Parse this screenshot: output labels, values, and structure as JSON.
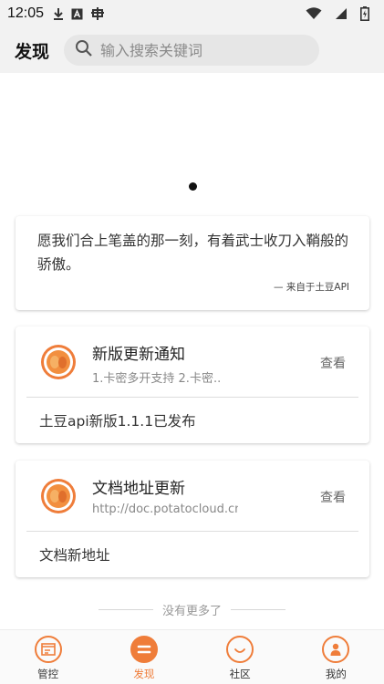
{
  "status_bar": {
    "time": "12:05",
    "icons": [
      "download-icon",
      "app-a-icon",
      "bug-icon",
      "wifi-icon",
      "signal-icon",
      "battery-icon"
    ]
  },
  "header": {
    "title": "发现",
    "search_placeholder": "输入搜索关键词"
  },
  "quote": {
    "text": "愿我们合上笔盖的那一刻，有着武士收刀入鞘般的骄傲。",
    "source": "— 来自于土豆API"
  },
  "notices": [
    {
      "title": "新版更新通知",
      "subtitle": "1.卡密多开支持 2.卡密..",
      "view_label": "查看",
      "body": "土豆api新版1.1.1已发布"
    },
    {
      "title": "文档地址更新",
      "subtitle": "http://doc.potatocloud.cn",
      "view_label": "查看",
      "body": "文档新地址"
    }
  ],
  "footer_note": "没有更多了",
  "tabs": [
    {
      "label": "管控",
      "icon": "console-icon",
      "active": false
    },
    {
      "label": "发现",
      "icon": "discover-icon",
      "active": true
    },
    {
      "label": "社区",
      "icon": "community-icon",
      "active": false
    },
    {
      "label": "我的",
      "icon": "profile-icon",
      "active": false
    }
  ],
  "colors": {
    "accent": "#ef7d3a",
    "background": "#ffffff",
    "bar": "#f2f2f2"
  }
}
